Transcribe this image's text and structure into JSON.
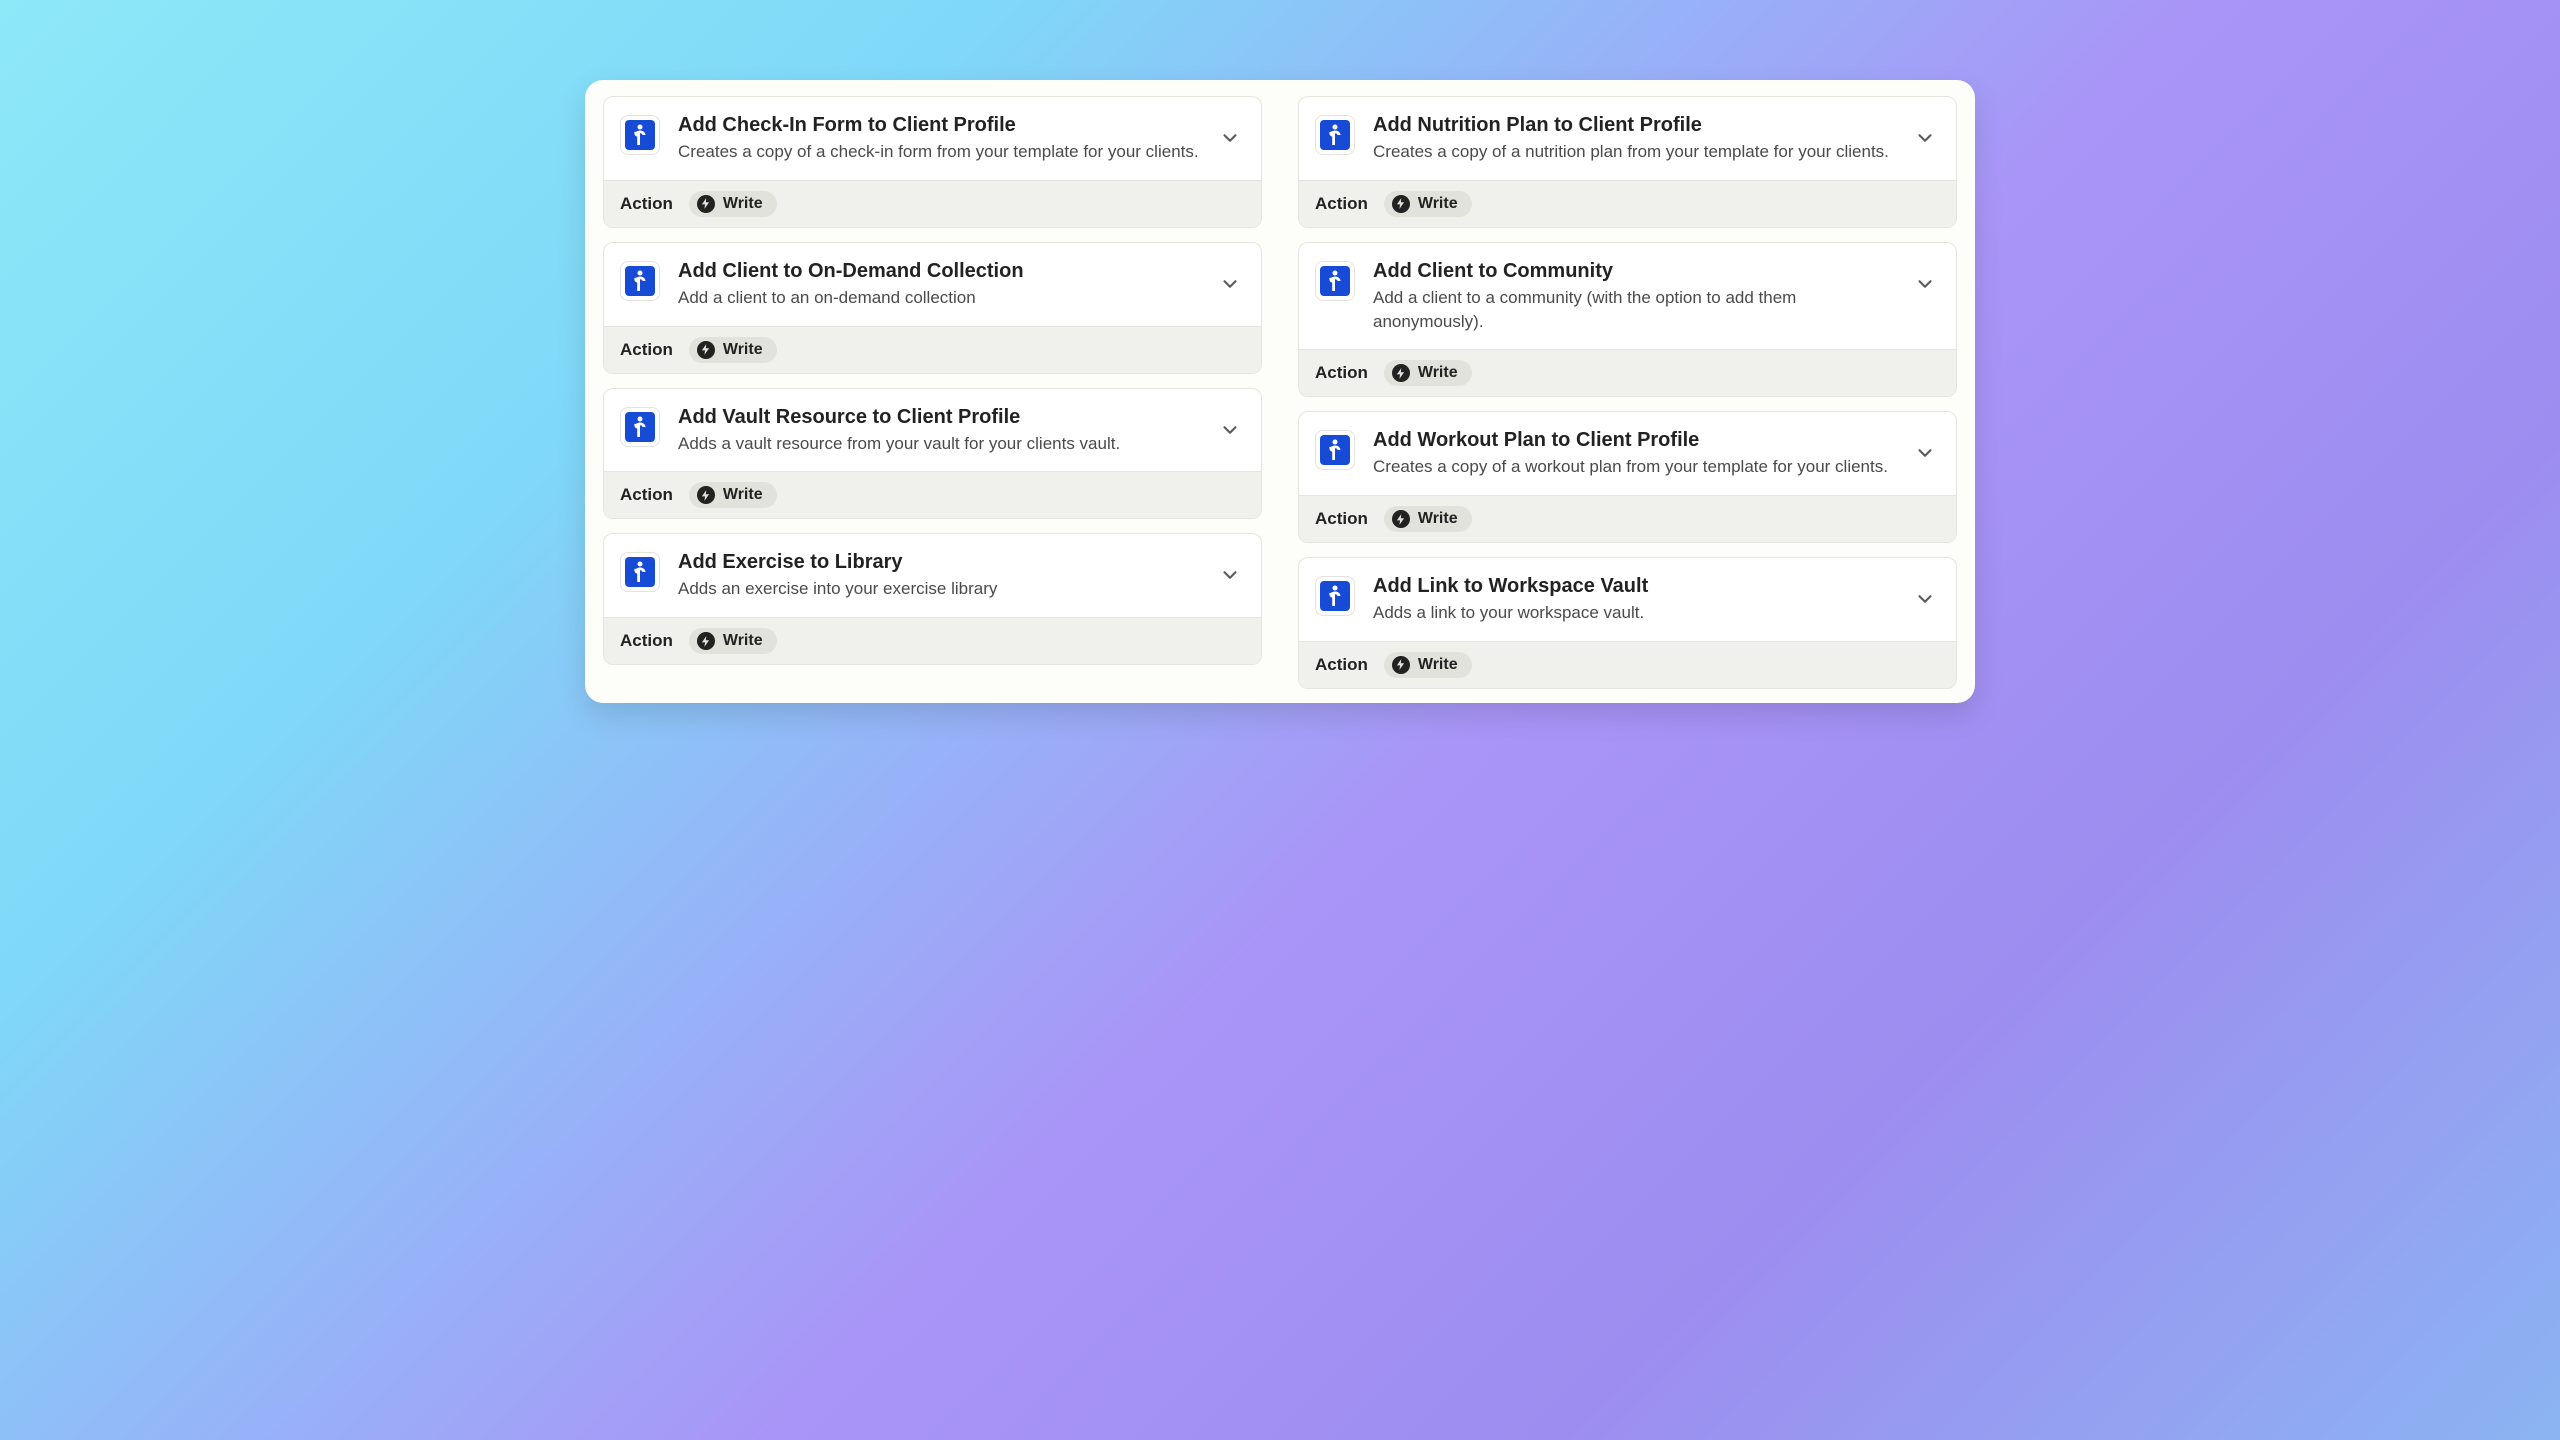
{
  "labels": {
    "action": "Action",
    "write": "Write"
  },
  "left": [
    {
      "title": "Add Check-In Form to Client Profile",
      "desc": "Creates a copy of a check-in form from your template for your clients."
    },
    {
      "title": "Add Client to On-Demand Collection",
      "desc": "Add a client to an on-demand collection"
    },
    {
      "title": "Add Vault Resource to Client Profile",
      "desc": "Adds a vault resource from your vault for your clients vault."
    },
    {
      "title": "Add Exercise to Library",
      "desc": "Adds an exercise into your exercise library"
    }
  ],
  "right": [
    {
      "title": "Add Nutrition Plan to Client Profile",
      "desc": "Creates a copy of a nutrition plan from your template for your clients."
    },
    {
      "title": "Add Client to Community",
      "desc": "Add a client to a community (with the option to add them anonymously)."
    },
    {
      "title": "Add Workout Plan to Client Profile",
      "desc": "Creates a copy of a workout plan from your template for your clients."
    },
    {
      "title": "Add Link to Workspace Vault",
      "desc": "Adds a link to your workspace vault."
    }
  ]
}
